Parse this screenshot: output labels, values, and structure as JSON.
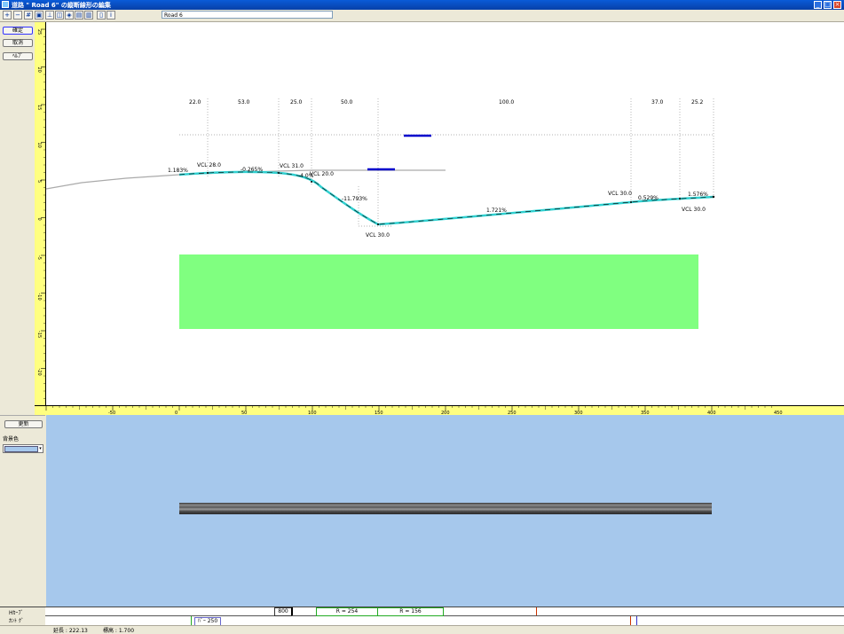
{
  "window": {
    "title": "道路 \" Road 6\" の縦断線形の編集",
    "controls": [
      "_",
      "□",
      "×"
    ]
  },
  "toolbar": {
    "road_name": "Road 6",
    "tools": [
      "zoom-in-icon",
      "zoom-out-icon",
      "grid-icon",
      "zoom-all-icon",
      "cross-section-icon",
      "view-icon",
      "layer-icon",
      "print-icon",
      "export-icon",
      "doc-icon",
      "info-icon"
    ]
  },
  "side_buttons": {
    "ok": "確定",
    "cancel": "取消",
    "help": "ﾍﾙﾌﾟ"
  },
  "preview_panel": {
    "update": "更新",
    "bg_label": "背景色",
    "bg_color": "#a6c8ec"
  },
  "profile": {
    "segment_lengths": [
      "22.0",
      "53.0",
      "25.0",
      "50.0",
      "100.0",
      "37.0",
      "25.2"
    ],
    "grades": [
      "1.183%",
      "-0.265%",
      "-4.0%",
      "-11.793%",
      "1.721%",
      "0.529%",
      "1.576%"
    ],
    "vcl_labels": [
      "VCL  28.0",
      "VCL  31.0",
      "VCL  20.0",
      "VCL  30.0",
      "VCL  30.0",
      "VCL  30.0"
    ],
    "colors": {
      "profile": "#30d0d0",
      "ground": "#aaaaaa",
      "band": "#80ff80",
      "marker": "#0000cc"
    }
  },
  "vertical_ruler": {
    "ticks": [
      "25",
      "20",
      "15",
      "10",
      "5",
      "0",
      "-5",
      "-10",
      "-15",
      "-20"
    ]
  },
  "horizontal_ruler": {
    "ticks": [
      "-50",
      "0",
      "50",
      "100",
      "150",
      "200",
      "250",
      "300",
      "350",
      "400",
      "450"
    ]
  },
  "curve_bar": {
    "row1_label": "Hｶｰﾌﾞ",
    "row2_label": "ｶﾝﾄ ｸﾞ",
    "boxes": [
      "800",
      "R = 254",
      "R = 156"
    ],
    "cant_box": "ﾊﾞｰ 250"
  },
  "status": {
    "length": "延長 : 222.13",
    "elevation": "標高 : 1.700"
  }
}
